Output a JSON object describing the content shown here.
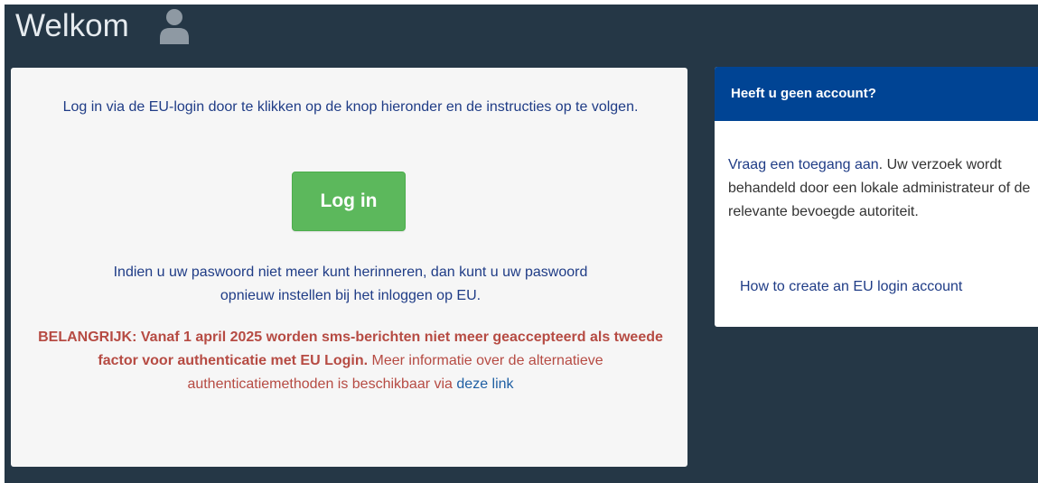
{
  "header": {
    "title": "Welkom",
    "icon": "user-icon"
  },
  "main": {
    "intro": "Log in via de EU-login door te klikken op de knop hieronder en de instructies op te volgen.",
    "login_button": "Log in",
    "reset_before": "Indien u uw paswoord niet meer kunt herinneren, dan kunt u uw paswoord",
    "reset_after": "opnieuw instellen bij het inloggen op EU.",
    "important_bold": "BELANGRIJK: Vanaf 1 april 2025 worden sms-berichten niet meer geaccepteerd als tweede factor voor authenticatie met EU Login.",
    "important_rest": " Meer informatie over de alternatieve authenticatiemethoden is beschikbaar via ",
    "important_link": "deze link"
  },
  "sidebar": {
    "title": "Heeft u geen account?",
    "request_link": "Vraag een toegang aan",
    "request_text": ". Uw verzoek wordt behandeld door een lokale administrateur of de relevante bevoegde autoriteit.",
    "howto_link": "How to create an EU login account"
  },
  "colors": {
    "background": "#253746",
    "header_blue": "#004494",
    "button_green": "#5cb85c",
    "warning_red": "#b64b43"
  }
}
